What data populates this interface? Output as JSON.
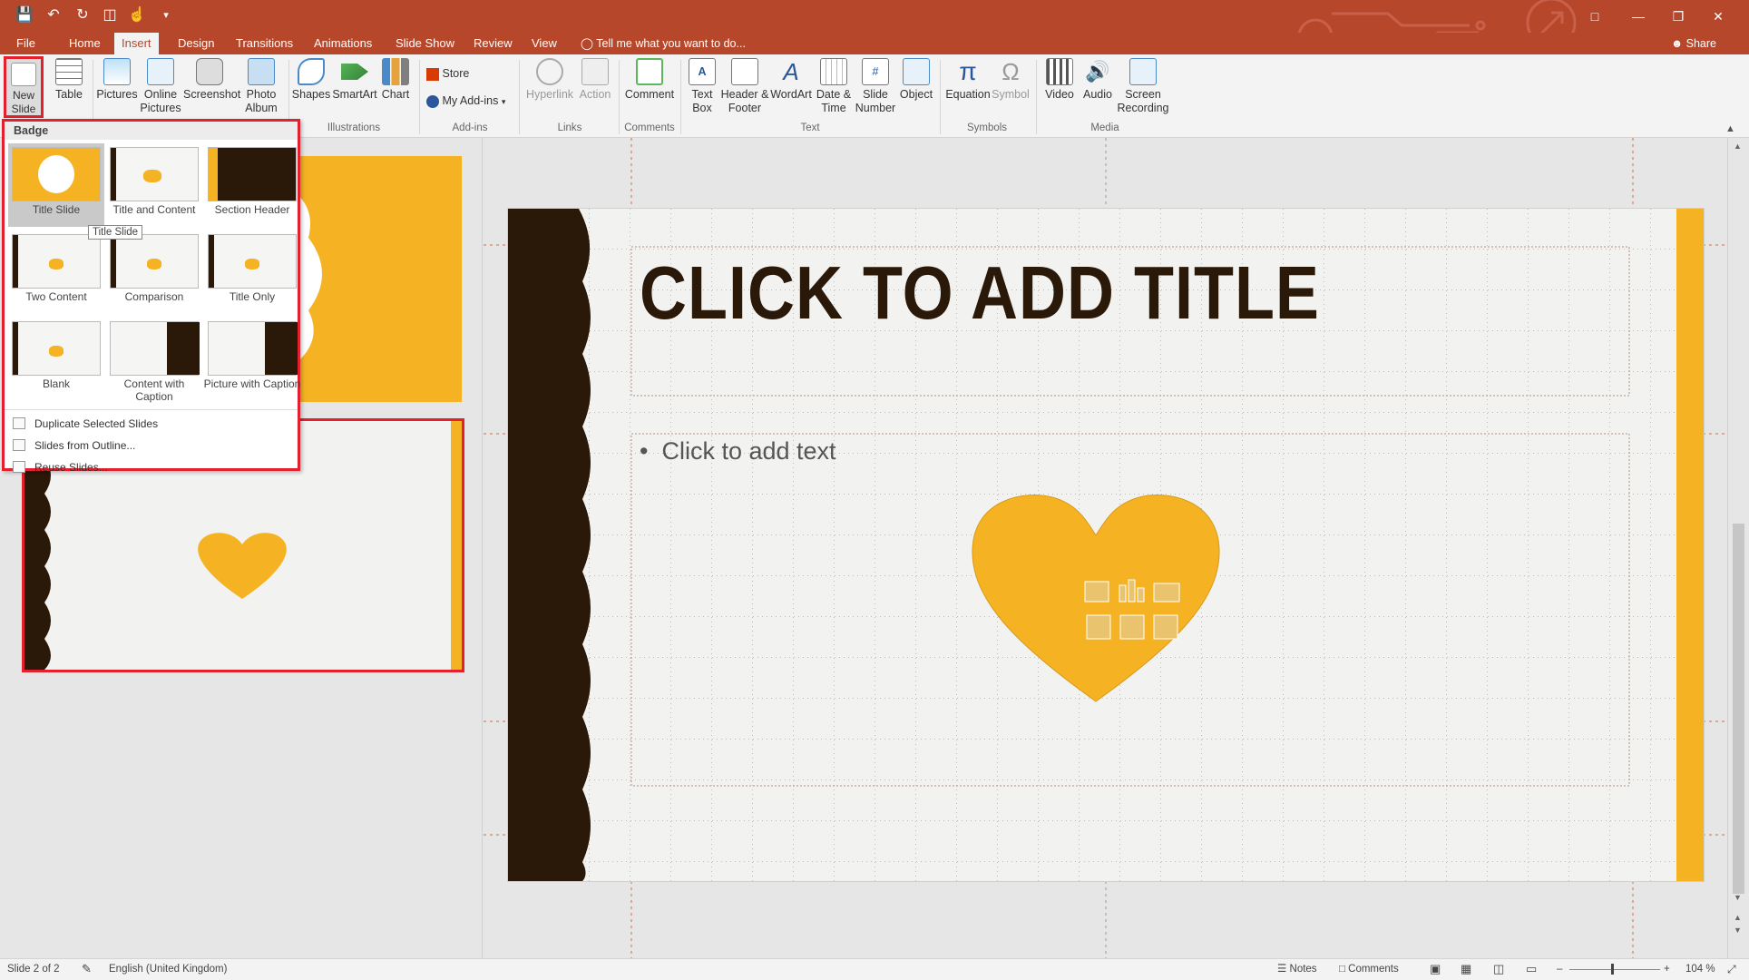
{
  "tabs": [
    "File",
    "Home",
    "Insert",
    "Design",
    "Transitions",
    "Animations",
    "Slide Show",
    "Review",
    "View"
  ],
  "active_tab": "Insert",
  "tell_me": "Tell me what you want to do...",
  "share": "Share",
  "ribbon": {
    "new_slide": "New Slide",
    "table": "Table",
    "pictures": "Pictures",
    "online_pictures": "Online Pictures",
    "screenshot": "Screenshot",
    "photo_album": "Photo Album",
    "shapes": "Shapes",
    "smartart": "SmartArt",
    "chart": "Chart",
    "store": "Store",
    "my_addins": "My Add-ins",
    "hyperlink": "Hyperlink",
    "action": "Action",
    "comment": "Comment",
    "text_box": "Text Box",
    "header_footer": "Header & Footer",
    "wordart": "WordArt",
    "date_time": "Date & Time",
    "slide_number": "Slide Number",
    "object": "Object",
    "equation": "Equation",
    "symbol": "Symbol",
    "video": "Video",
    "audio": "Audio",
    "screen_recording": "Screen Recording",
    "groups": {
      "illustrations": "Illustrations",
      "addins": "Add-ins",
      "links": "Links",
      "comments": "Comments",
      "text": "Text",
      "symbols": "Symbols",
      "media": "Media"
    }
  },
  "gallery": {
    "header": "Badge",
    "layouts": [
      "Title Slide",
      "Title and Content",
      "Section Header",
      "Two Content",
      "Comparison",
      "Title Only",
      "Blank",
      "Content with Caption",
      "Picture with Caption"
    ],
    "tooltip": "Title Slide",
    "menu": [
      "Duplicate Selected Slides",
      "Slides from Outline...",
      "Reuse Slides..."
    ]
  },
  "slide": {
    "title": "CLICK TO ADD TITLE",
    "bullet": "Click to add text"
  },
  "status": {
    "slide_info": "Slide 2 of 2",
    "language": "English (United Kingdom)",
    "notes": "Notes",
    "comments": "Comments",
    "zoom": "104 %"
  },
  "colors": {
    "accent": "#b7472a",
    "gold": "#f5b324",
    "dark": "#2a1808",
    "highlight": "#e3202d"
  }
}
